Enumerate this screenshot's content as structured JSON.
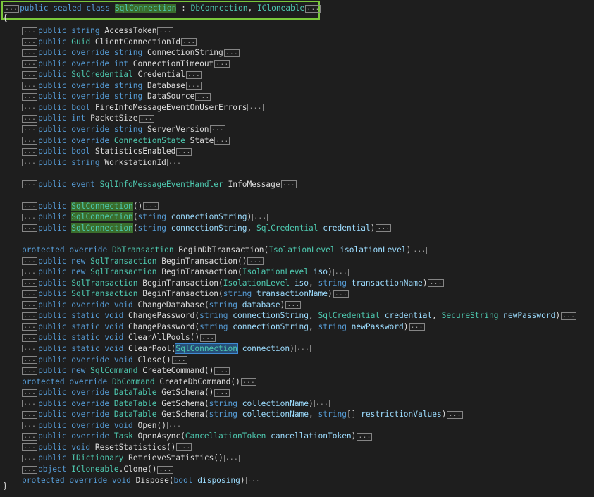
{
  "editor": {
    "declaration": [
      {
        "t": "public",
        "c": "kw"
      },
      {
        "t": " ",
        "c": "pn"
      },
      {
        "t": "sealed",
        "c": "kw"
      },
      {
        "t": " ",
        "c": "pn"
      },
      {
        "t": "class",
        "c": "kw"
      },
      {
        "t": " ",
        "c": "pn"
      },
      {
        "t": "SqlConnection",
        "c": "hl"
      },
      {
        "t": " : ",
        "c": "pn"
      },
      {
        "t": "DbConnection",
        "c": "ty"
      },
      {
        "t": ", ",
        "c": "pn"
      },
      {
        "t": "ICloneable",
        "c": "ty"
      }
    ],
    "collapse_label": "...",
    "open_brace": "{",
    "close_brace": "}",
    "lines": [
      {
        "row": 0,
        "c": true,
        "tokens": [
          {
            "t": "public",
            "c": "kw"
          },
          {
            "t": " string ",
            "c": "kw"
          },
          {
            "t": "AccessToken",
            "c": "id"
          }
        ],
        "tail": true
      },
      {
        "row": 1,
        "c": true,
        "tokens": [
          {
            "t": "public",
            "c": "kw"
          },
          {
            "t": " ",
            "c": "pn"
          },
          {
            "t": "Guid",
            "c": "ty"
          },
          {
            "t": " ClientConnectionId",
            "c": "id"
          }
        ],
        "tail": true
      },
      {
        "row": 2,
        "c": true,
        "tokens": [
          {
            "t": "public override string",
            "c": "kw"
          },
          {
            "t": " ConnectionString",
            "c": "id"
          }
        ],
        "tail": true
      },
      {
        "row": 3,
        "c": true,
        "tokens": [
          {
            "t": "public override int",
            "c": "kw"
          },
          {
            "t": " ConnectionTimeout",
            "c": "id"
          }
        ],
        "tail": true
      },
      {
        "row": 4,
        "c": true,
        "tokens": [
          {
            "t": "public",
            "c": "kw"
          },
          {
            "t": " ",
            "c": "pn"
          },
          {
            "t": "SqlCredential",
            "c": "ty"
          },
          {
            "t": " Credential",
            "c": "id"
          }
        ],
        "tail": true
      },
      {
        "row": 5,
        "c": true,
        "tokens": [
          {
            "t": "public override string",
            "c": "kw"
          },
          {
            "t": " Database",
            "c": "id"
          }
        ],
        "tail": true
      },
      {
        "row": 6,
        "c": true,
        "tokens": [
          {
            "t": "public override string",
            "c": "kw"
          },
          {
            "t": " DataSource",
            "c": "id"
          }
        ],
        "tail": true
      },
      {
        "row": 7,
        "c": true,
        "tokens": [
          {
            "t": "public bool",
            "c": "kw"
          },
          {
            "t": " FireInfoMessageEventOnUserErrors",
            "c": "id"
          }
        ],
        "tail": true
      },
      {
        "row": 8,
        "c": true,
        "tokens": [
          {
            "t": "public int",
            "c": "kw"
          },
          {
            "t": " PacketSize",
            "c": "id"
          }
        ],
        "tail": true
      },
      {
        "row": 9,
        "c": true,
        "tokens": [
          {
            "t": "public override string",
            "c": "kw"
          },
          {
            "t": " ServerVersion",
            "c": "id"
          }
        ],
        "tail": true
      },
      {
        "row": 10,
        "c": true,
        "tokens": [
          {
            "t": "public override",
            "c": "kw"
          },
          {
            "t": " ",
            "c": "pn"
          },
          {
            "t": "ConnectionState",
            "c": "ty"
          },
          {
            "t": " State",
            "c": "id"
          }
        ],
        "tail": true
      },
      {
        "row": 11,
        "c": true,
        "tokens": [
          {
            "t": "public bool",
            "c": "kw"
          },
          {
            "t": " StatisticsEnabled",
            "c": "id"
          }
        ],
        "tail": true
      },
      {
        "row": 12,
        "c": true,
        "tokens": [
          {
            "t": "public string",
            "c": "kw"
          },
          {
            "t": " WorkstationId",
            "c": "id"
          }
        ],
        "tail": true
      },
      {
        "row": 14,
        "c": true,
        "tokens": [
          {
            "t": "public event",
            "c": "kw"
          },
          {
            "t": " ",
            "c": "pn"
          },
          {
            "t": "SqlInfoMessageEventHandler",
            "c": "ty"
          },
          {
            "t": " InfoMessage",
            "c": "id"
          }
        ],
        "tail": true
      },
      {
        "row": 16,
        "c": true,
        "tokens": [
          {
            "t": "public",
            "c": "kw"
          },
          {
            "t": " ",
            "c": "pn"
          },
          {
            "t": "SqlConnection",
            "c": "hl"
          },
          {
            "t": "()",
            "c": "pn"
          }
        ],
        "tail": true
      },
      {
        "row": 17,
        "c": true,
        "tokens": [
          {
            "t": "public",
            "c": "kw"
          },
          {
            "t": " ",
            "c": "pn"
          },
          {
            "t": "SqlConnection",
            "c": "hl"
          },
          {
            "t": "(",
            "c": "pn"
          },
          {
            "t": "string",
            "c": "kw"
          },
          {
            "t": " connectionString",
            "c": "pm"
          },
          {
            "t": ")",
            "c": "pn"
          }
        ],
        "tail": true
      },
      {
        "row": 18,
        "c": true,
        "tokens": [
          {
            "t": "public",
            "c": "kw"
          },
          {
            "t": " ",
            "c": "pn"
          },
          {
            "t": "SqlConnection",
            "c": "hl"
          },
          {
            "t": "(",
            "c": "pn"
          },
          {
            "t": "string",
            "c": "kw"
          },
          {
            "t": " connectionString",
            "c": "pm"
          },
          {
            "t": ", ",
            "c": "pn"
          },
          {
            "t": "SqlCredential",
            "c": "ty"
          },
          {
            "t": " credential",
            "c": "pm"
          },
          {
            "t": ")",
            "c": "pn"
          }
        ],
        "tail": true
      },
      {
        "row": 20,
        "c": false,
        "tokens": [
          {
            "t": "protected override",
            "c": "kw"
          },
          {
            "t": " ",
            "c": "pn"
          },
          {
            "t": "DbTransaction",
            "c": "ty"
          },
          {
            "t": " BeginDbTransaction(",
            "c": "id"
          },
          {
            "t": "IsolationLevel",
            "c": "ty"
          },
          {
            "t": " isolationLevel",
            "c": "pm"
          },
          {
            "t": ")",
            "c": "pn"
          }
        ],
        "tail": true
      },
      {
        "row": 21,
        "c": true,
        "tokens": [
          {
            "t": "public new",
            "c": "kw"
          },
          {
            "t": " ",
            "c": "pn"
          },
          {
            "t": "SqlTransaction",
            "c": "ty"
          },
          {
            "t": " BeginTransaction()",
            "c": "id"
          }
        ],
        "tail": true
      },
      {
        "row": 22,
        "c": true,
        "tokens": [
          {
            "t": "public new",
            "c": "kw"
          },
          {
            "t": " ",
            "c": "pn"
          },
          {
            "t": "SqlTransaction",
            "c": "ty"
          },
          {
            "t": " BeginTransaction(",
            "c": "id"
          },
          {
            "t": "IsolationLevel",
            "c": "ty"
          },
          {
            "t": " iso",
            "c": "pm"
          },
          {
            "t": ")",
            "c": "pn"
          }
        ],
        "tail": true
      },
      {
        "row": 23,
        "c": true,
        "tokens": [
          {
            "t": "public",
            "c": "kw"
          },
          {
            "t": " ",
            "c": "pn"
          },
          {
            "t": "SqlTransaction",
            "c": "ty"
          },
          {
            "t": " BeginTransaction(",
            "c": "id"
          },
          {
            "t": "IsolationLevel",
            "c": "ty"
          },
          {
            "t": " iso",
            "c": "pm"
          },
          {
            "t": ", ",
            "c": "pn"
          },
          {
            "t": "string",
            "c": "kw"
          },
          {
            "t": " transactionName",
            "c": "pm"
          },
          {
            "t": ")",
            "c": "pn"
          }
        ],
        "tail": true
      },
      {
        "row": 24,
        "c": true,
        "tokens": [
          {
            "t": "public",
            "c": "kw"
          },
          {
            "t": " ",
            "c": "pn"
          },
          {
            "t": "SqlTransaction",
            "c": "ty"
          },
          {
            "t": " BeginTransaction(",
            "c": "id"
          },
          {
            "t": "string",
            "c": "kw"
          },
          {
            "t": " transactionName",
            "c": "pm"
          },
          {
            "t": ")",
            "c": "pn"
          }
        ],
        "tail": true
      },
      {
        "row": 25,
        "c": true,
        "tokens": [
          {
            "t": "public override void",
            "c": "kw"
          },
          {
            "t": " ChangeDatabase(",
            "c": "id"
          },
          {
            "t": "string",
            "c": "kw"
          },
          {
            "t": " database",
            "c": "pm"
          },
          {
            "t": ")",
            "c": "pn"
          }
        ],
        "tail": true
      },
      {
        "row": 26,
        "c": true,
        "tokens": [
          {
            "t": "public static void",
            "c": "kw"
          },
          {
            "t": " ChangePassword(",
            "c": "id"
          },
          {
            "t": "string",
            "c": "kw"
          },
          {
            "t": " connectionString",
            "c": "pm"
          },
          {
            "t": ", ",
            "c": "pn"
          },
          {
            "t": "SqlCredential",
            "c": "ty"
          },
          {
            "t": " credential",
            "c": "pm"
          },
          {
            "t": ", ",
            "c": "pn"
          },
          {
            "t": "SecureString",
            "c": "ty"
          },
          {
            "t": " newPassword",
            "c": "pm"
          },
          {
            "t": ")",
            "c": "pn"
          }
        ],
        "tail": true
      },
      {
        "row": 27,
        "c": true,
        "tokens": [
          {
            "t": "public static void",
            "c": "kw"
          },
          {
            "t": " ChangePassword(",
            "c": "id"
          },
          {
            "t": "string",
            "c": "kw"
          },
          {
            "t": " connectionString",
            "c": "pm"
          },
          {
            "t": ", ",
            "c": "pn"
          },
          {
            "t": "string",
            "c": "kw"
          },
          {
            "t": " newPassword",
            "c": "pm"
          },
          {
            "t": ")",
            "c": "pn"
          }
        ],
        "tail": true
      },
      {
        "row": 28,
        "c": true,
        "tokens": [
          {
            "t": "public static void",
            "c": "kw"
          },
          {
            "t": " ClearAllPools()",
            "c": "id"
          }
        ],
        "tail": true
      },
      {
        "row": 29,
        "c": true,
        "tokens": [
          {
            "t": "public static void",
            "c": "kw"
          },
          {
            "t": " ClearPool(",
            "c": "id"
          },
          {
            "t": "SqlConnection",
            "c": "hlsel"
          },
          {
            "t": " connection",
            "c": "pm"
          },
          {
            "t": ")",
            "c": "pn"
          }
        ],
        "tail": true
      },
      {
        "row": 30,
        "c": true,
        "tokens": [
          {
            "t": "public override void",
            "c": "kw"
          },
          {
            "t": " Close()",
            "c": "id"
          }
        ],
        "tail": true
      },
      {
        "row": 31,
        "c": true,
        "tokens": [
          {
            "t": "public new",
            "c": "kw"
          },
          {
            "t": " ",
            "c": "pn"
          },
          {
            "t": "SqlCommand",
            "c": "ty"
          },
          {
            "t": " CreateCommand()",
            "c": "id"
          }
        ],
        "tail": true
      },
      {
        "row": 32,
        "c": false,
        "tokens": [
          {
            "t": "protected override",
            "c": "kw"
          },
          {
            "t": " ",
            "c": "pn"
          },
          {
            "t": "DbCommand",
            "c": "ty"
          },
          {
            "t": " CreateDbCommand()",
            "c": "id"
          }
        ],
        "tail": true
      },
      {
        "row": 33,
        "c": true,
        "tokens": [
          {
            "t": "public override",
            "c": "kw"
          },
          {
            "t": " ",
            "c": "pn"
          },
          {
            "t": "DataTable",
            "c": "ty"
          },
          {
            "t": " GetSchema()",
            "c": "id"
          }
        ],
        "tail": true
      },
      {
        "row": 34,
        "c": true,
        "tokens": [
          {
            "t": "public override",
            "c": "kw"
          },
          {
            "t": " ",
            "c": "pn"
          },
          {
            "t": "DataTable",
            "c": "ty"
          },
          {
            "t": " GetSchema(",
            "c": "id"
          },
          {
            "t": "string",
            "c": "kw"
          },
          {
            "t": " collectionName",
            "c": "pm"
          },
          {
            "t": ")",
            "c": "pn"
          }
        ],
        "tail": true
      },
      {
        "row": 35,
        "c": true,
        "tokens": [
          {
            "t": "public override",
            "c": "kw"
          },
          {
            "t": " ",
            "c": "pn"
          },
          {
            "t": "DataTable",
            "c": "ty"
          },
          {
            "t": " GetSchema(",
            "c": "id"
          },
          {
            "t": "string",
            "c": "kw"
          },
          {
            "t": " collectionName",
            "c": "pm"
          },
          {
            "t": ", ",
            "c": "pn"
          },
          {
            "t": "string",
            "c": "kw"
          },
          {
            "t": "[] ",
            "c": "pn"
          },
          {
            "t": "restrictionValues",
            "c": "pm"
          },
          {
            "t": ")",
            "c": "pn"
          }
        ],
        "tail": true
      },
      {
        "row": 36,
        "c": true,
        "tokens": [
          {
            "t": "public override void",
            "c": "kw"
          },
          {
            "t": " Open()",
            "c": "id"
          }
        ],
        "tail": true
      },
      {
        "row": 37,
        "c": true,
        "tokens": [
          {
            "t": "public override",
            "c": "kw"
          },
          {
            "t": " ",
            "c": "pn"
          },
          {
            "t": "Task",
            "c": "ty"
          },
          {
            "t": " OpenAsync(",
            "c": "id"
          },
          {
            "t": "CancellationToken",
            "c": "ty"
          },
          {
            "t": " cancellationToken",
            "c": "pm"
          },
          {
            "t": ")",
            "c": "pn"
          }
        ],
        "tail": true
      },
      {
        "row": 38,
        "c": true,
        "tokens": [
          {
            "t": "public void",
            "c": "kw"
          },
          {
            "t": " ResetStatistics()",
            "c": "id"
          }
        ],
        "tail": true
      },
      {
        "row": 39,
        "c": true,
        "tokens": [
          {
            "t": "public",
            "c": "kw"
          },
          {
            "t": " ",
            "c": "pn"
          },
          {
            "t": "IDictionary",
            "c": "ty"
          },
          {
            "t": " RetrieveStatistics()",
            "c": "id"
          }
        ],
        "tail": true
      },
      {
        "row": 40,
        "c": true,
        "tokens": [
          {
            "t": "object",
            "c": "kw"
          },
          {
            "t": " ",
            "c": "pn"
          },
          {
            "t": "ICloneable",
            "c": "ty"
          },
          {
            "t": ".Clone()",
            "c": "id"
          }
        ],
        "tail": true
      },
      {
        "row": 41,
        "c": false,
        "tokens": [
          {
            "t": "protected override void",
            "c": "kw"
          },
          {
            "t": " Dispose(",
            "c": "id"
          },
          {
            "t": "bool",
            "c": "kw"
          },
          {
            "t": " disposing",
            "c": "pm"
          },
          {
            "t": ")",
            "c": "pn"
          }
        ],
        "tail": true
      }
    ]
  }
}
